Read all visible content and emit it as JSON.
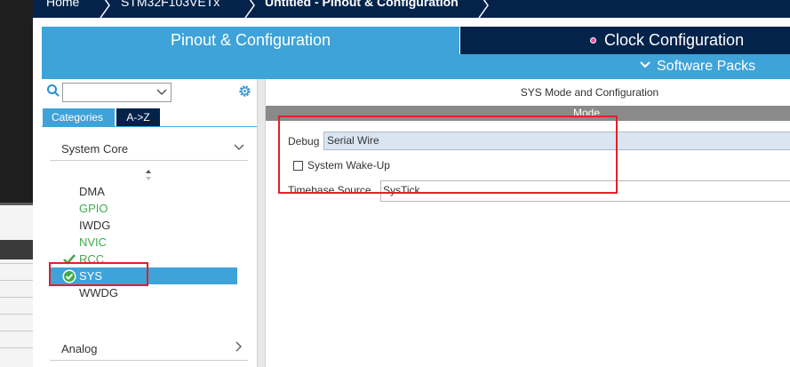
{
  "breadcrumb": {
    "items": [
      "Home",
      "STM32F103VETx",
      "Untitled - Pinout & Configuration"
    ]
  },
  "tabs": {
    "pinout": "Pinout & Configuration",
    "clock": "Clock Configuration",
    "software_packs": "Software Packs"
  },
  "left": {
    "category_tabs": [
      "Categories",
      "A->Z"
    ],
    "group_system": "System Core",
    "items": [
      {
        "label": "DMA",
        "status": "none"
      },
      {
        "label": "GPIO",
        "status": "configured"
      },
      {
        "label": "IWDG",
        "status": "none"
      },
      {
        "label": "NVIC",
        "status": "configured"
      },
      {
        "label": "RCC",
        "status": "checked"
      },
      {
        "label": "SYS",
        "status": "checked-selected"
      },
      {
        "label": "WWDG",
        "status": "none"
      }
    ],
    "group_analog": "Analog"
  },
  "right": {
    "title": "SYS Mode and Configuration",
    "section": "Mode",
    "debug_label": "Debug",
    "debug_value": "Serial Wire",
    "wakeup_label": "System Wake-Up",
    "wakeup_checked": false,
    "timebase_label": "Timebase Source",
    "timebase_value": "SysTick"
  },
  "colors": {
    "navy": "#03234b",
    "blue": "#3ea3d9",
    "green": "#3eab4f",
    "annotation_red": "#e0202a"
  }
}
